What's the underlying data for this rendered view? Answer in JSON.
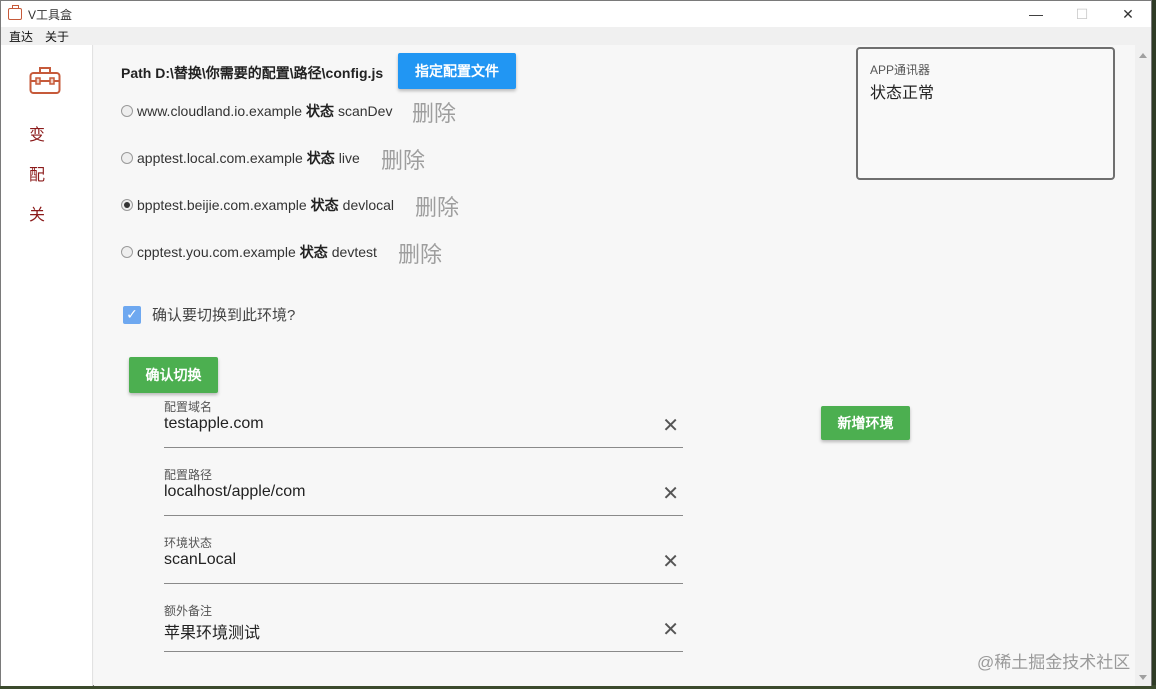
{
  "window": {
    "title": "V工具盒",
    "minimize_glyph": "—",
    "maximize_glyph": "☐",
    "close_glyph": "✕"
  },
  "menu": [
    "直达",
    "关于"
  ],
  "sidebar": {
    "icon": "toolbox-icon",
    "items": [
      "变",
      "配",
      "关"
    ]
  },
  "path": {
    "label": "Path D:\\替换\\你需要的配置\\路径\\config.js",
    "button": "指定配置文件"
  },
  "environments": [
    {
      "domain": "www.cloudland.io.example",
      "status_label": "状态",
      "status": "scanDev",
      "delete": "删除",
      "selected": false
    },
    {
      "domain": "apptest.local.com.example",
      "status_label": "状态",
      "status": "live",
      "delete": "删除",
      "selected": false
    },
    {
      "domain": "bpptest.beijie.com.example",
      "status_label": "状态",
      "status": "devlocal",
      "delete": "删除",
      "selected": true
    },
    {
      "domain": "cpptest.you.com.example",
      "status_label": "状态",
      "status": "devtest",
      "delete": "删除",
      "selected": false
    }
  ],
  "confirm": {
    "checkbox_label": "确认要切换到此环境?",
    "checked": true,
    "button": "确认切换"
  },
  "form": {
    "fields": [
      {
        "label": "配置域名",
        "value": "testapple.com"
      },
      {
        "label": "配置路径",
        "value": "localhost/apple/com"
      },
      {
        "label": "环境状态",
        "value": "scanLocal"
      },
      {
        "label": "额外备注",
        "value": "苹果环境测试"
      }
    ],
    "clear_glyph": "✕",
    "add_button": "新增环境"
  },
  "communicator": {
    "title": "APP通讯器",
    "status": "状态正常"
  },
  "watermark": "@稀土掘金技术社区",
  "colors": {
    "primary_blue": "#2196f3",
    "success_green": "#4caf50",
    "sidebar_text": "#8b1a1a",
    "delete_gray": "#9e9e9e"
  }
}
